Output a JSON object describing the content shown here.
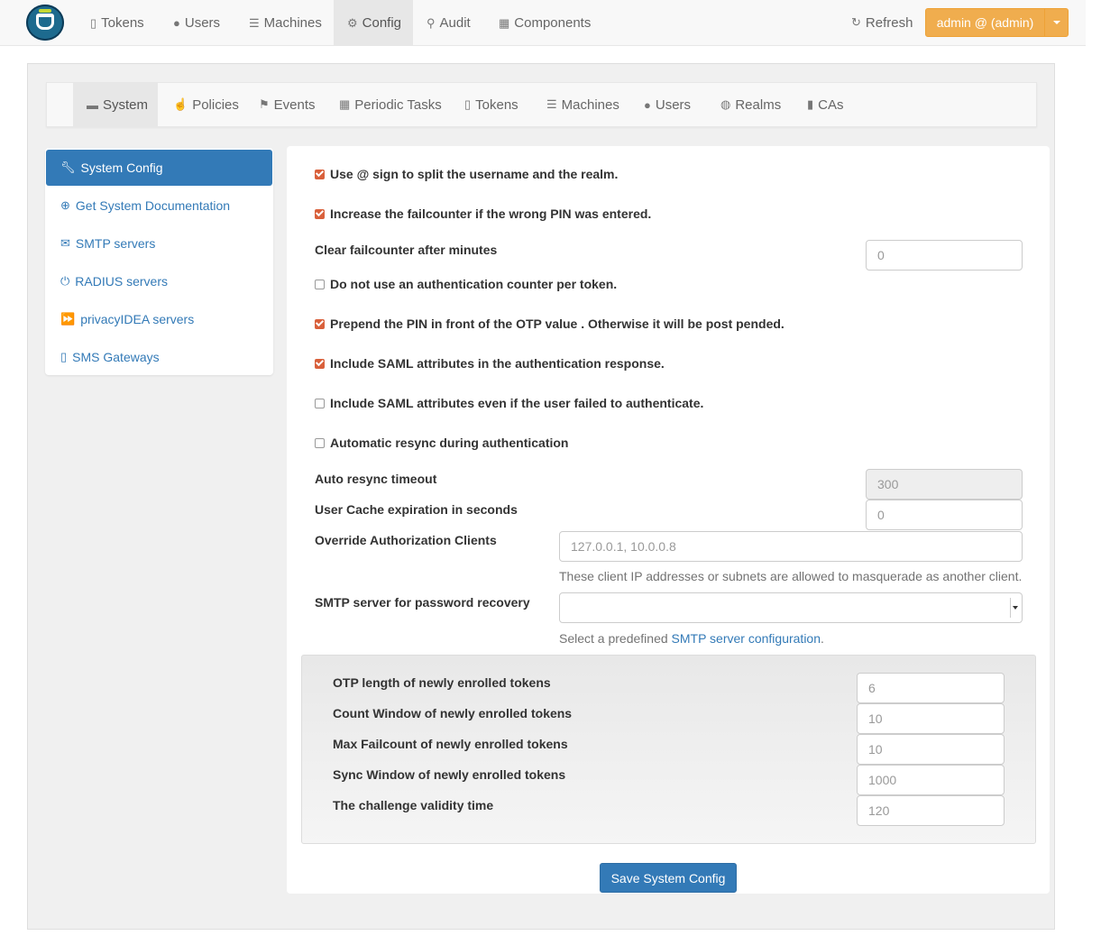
{
  "navbar": {
    "items": [
      {
        "label": "Tokens",
        "icon": "mobile-icon"
      },
      {
        "label": "Users",
        "icon": "user-icon"
      },
      {
        "label": "Machines",
        "icon": "server-icon"
      },
      {
        "label": "Config",
        "icon": "gear-icon",
        "active": true
      },
      {
        "label": "Audit",
        "icon": "search-icon"
      },
      {
        "label": "Components",
        "icon": "calendar-icon"
      }
    ],
    "refresh_label": "Refresh",
    "admin_label": "admin @ (admin)",
    "accent": "#f0ad4e"
  },
  "subnav": {
    "items": [
      {
        "label": "System",
        "icon": "briefcase-icon",
        "active": true
      },
      {
        "label": "Policies",
        "icon": "hand-icon"
      },
      {
        "label": "Events",
        "icon": "flag-icon"
      },
      {
        "label": "Periodic Tasks",
        "icon": "calendar-icon"
      },
      {
        "label": "Tokens",
        "icon": "mobile-icon"
      },
      {
        "label": "Machines",
        "icon": "server-icon"
      },
      {
        "label": "Users",
        "icon": "user-icon"
      },
      {
        "label": "Realms",
        "icon": "globe-icon"
      },
      {
        "label": "CAs",
        "icon": "bookmark-icon"
      }
    ]
  },
  "sidebar": {
    "items": [
      {
        "label": "System Config",
        "icon": "wrench-icon",
        "active": true
      },
      {
        "label": "Get System Documentation",
        "icon": "download-icon"
      },
      {
        "label": "SMTP servers",
        "icon": "envelope-icon"
      },
      {
        "label": "RADIUS servers",
        "icon": "power-icon"
      },
      {
        "label": "privacyIDEA servers",
        "icon": "fast-forward-icon"
      },
      {
        "label": "SMS Gateways",
        "icon": "mobile-icon"
      }
    ]
  },
  "form": {
    "split_at_sign": {
      "label": "Use @ sign to split the username and the realm.",
      "checked": true
    },
    "increase_failcounter": {
      "label": "Increase the failcounter if the wrong PIN was entered.",
      "checked": true
    },
    "clear_failcounter": {
      "label": "Clear failcounter after minutes",
      "value": "0"
    },
    "no_auth_counter": {
      "label": "Do not use an authentication counter per token.",
      "checked": false
    },
    "prepend_pin": {
      "label": "Prepend the PIN in front of the OTP value . Otherwise it will be post pended.",
      "checked": true
    },
    "include_saml": {
      "label": "Include SAML attributes in the authentication response.",
      "checked": true
    },
    "include_saml_fail": {
      "label": "Include SAML attributes even if the user failed to authenticate.",
      "checked": false
    },
    "auto_resync": {
      "label": "Automatic resync during authentication",
      "checked": false
    },
    "auto_resync_timeout": {
      "label": "Auto resync timeout",
      "value": "300"
    },
    "user_cache": {
      "label": "User Cache expiration in seconds",
      "value": "0"
    },
    "override_clients": {
      "label": "Override Authorization Clients",
      "placeholder": "127.0.0.1, 10.0.0.8",
      "help": "These client IP addresses or subnets are allowed to masquerade as another client."
    },
    "smtp_recovery": {
      "label": "SMTP server for password recovery",
      "value": "",
      "help_prefix": "Select a predefined ",
      "help_link": "SMTP server configuration",
      "help_suffix": "."
    }
  },
  "token_defaults": {
    "otp_length": {
      "label": "OTP length of newly enrolled tokens",
      "value": "6"
    },
    "count_window": {
      "label": "Count Window of newly enrolled tokens",
      "value": "10"
    },
    "max_failcount": {
      "label": "Max Failcount of newly enrolled tokens",
      "value": "10"
    },
    "sync_window": {
      "label": "Sync Window of newly enrolled tokens",
      "value": "1000"
    },
    "challenge_validity": {
      "label": "The challenge validity time",
      "value": "120"
    }
  },
  "save_label": "Save System Config",
  "colors": {
    "primary": "#337ab7",
    "checkbox": "#d9603b"
  }
}
